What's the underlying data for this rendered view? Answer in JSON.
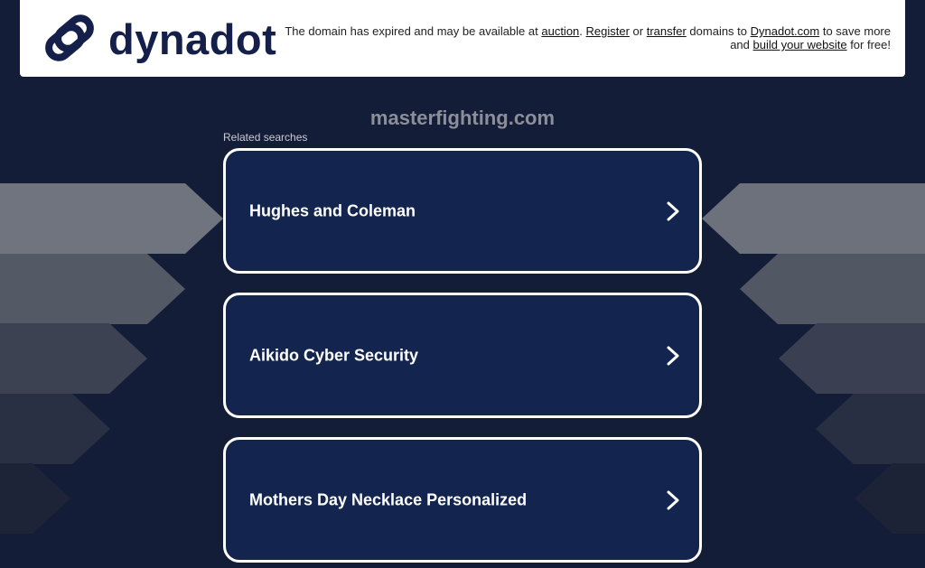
{
  "header": {
    "logo_text": "dynadot",
    "notice": {
      "part1": "The domain has expired and may be available at ",
      "auction_link": "auction",
      "part2": ". ",
      "register_link": "Register",
      "part3": " or ",
      "transfer_link": "transfer",
      "part4": " domains to ",
      "dynadot_link": "Dynadot.com",
      "part5": " to save more and ",
      "build_link": "build your website",
      "part6": " for free!"
    }
  },
  "domain": "masterfighting.com",
  "related_searches_label": "Related searches",
  "searches": [
    {
      "label": "Hughes and Coleman",
      "icon": "chevron-right-icon"
    },
    {
      "label": "Aikido Cyber Security",
      "icon": "chevron-right-icon"
    },
    {
      "label": "Mothers Day Necklace Personalized",
      "icon": "chevron-right-icon"
    }
  ],
  "colors": {
    "background": "#141d38",
    "card_bg": "#13254f",
    "card_border": "#ffffff",
    "logo": "#15204a",
    "domain_title": "#8c8f99"
  }
}
